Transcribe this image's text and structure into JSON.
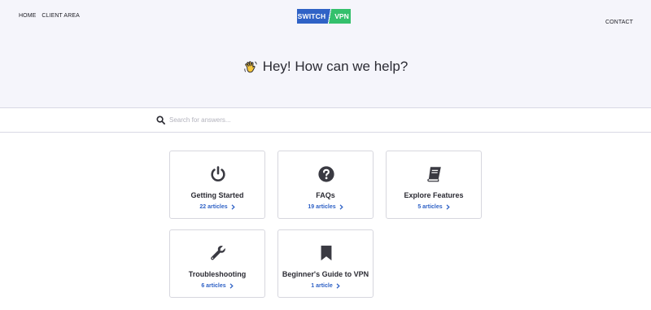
{
  "nav": {
    "left": [
      "HOME",
      "CLIENT AREA"
    ],
    "right": "CONTACT"
  },
  "logo": {
    "part1": "SWITCH",
    "part2": "VPN"
  },
  "hero": {
    "title": "Hey! How can we help?",
    "icon": "waving-hand-icon"
  },
  "search": {
    "placeholder": "Search for answers...",
    "value": "",
    "icon": "search-icon"
  },
  "cards": [
    {
      "title": "Getting Started",
      "count": "22 articles",
      "icon": "power-icon"
    },
    {
      "title": "FAQs",
      "count": "19 articles",
      "icon": "question-circle-icon"
    },
    {
      "title": "Explore Features",
      "count": "5 articles",
      "icon": "book-icon"
    },
    {
      "title": "Troubleshooting",
      "count": "6 articles",
      "icon": "wrench-icon"
    },
    {
      "title": "Beginner's Guide to VPN",
      "count": "1 article",
      "icon": "bookmark-icon"
    }
  ],
  "colors": {
    "accent": "#2f62c6",
    "brand_green": "#34c06c",
    "hero_bg": "#f5f5fb",
    "icon": "#3a3a42"
  }
}
